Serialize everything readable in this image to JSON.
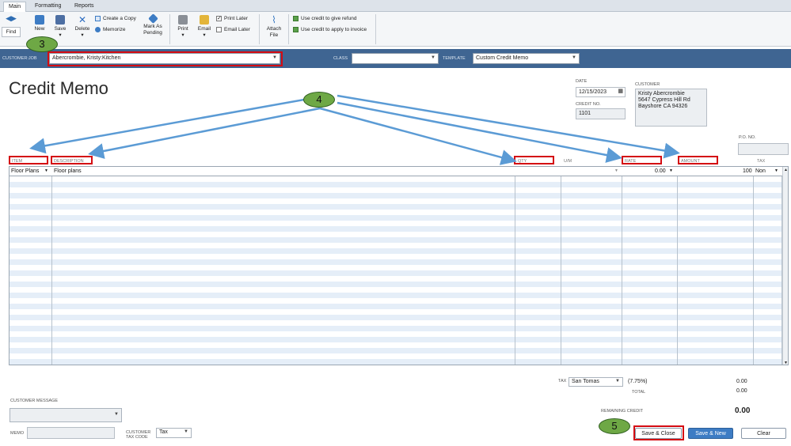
{
  "tabs": [
    "Main",
    "Formatting",
    "Reports"
  ],
  "ribbon": {
    "find": "Find",
    "new": "New",
    "save": "Save",
    "delete": "Delete",
    "create_copy": "Create a Copy",
    "memorize": "Memorize",
    "mark_as_pending": [
      "Mark As",
      "Pending"
    ],
    "print": "Print",
    "email": "Email",
    "print_later": "Print Later",
    "email_later": "Email Later",
    "attach_file": [
      "Attach",
      "File"
    ],
    "use_credit_refund": "Use credit to give refund",
    "use_credit_invoice": "Use credit to apply to invoice"
  },
  "custbar": {
    "customer_job_label": "CUSTOMER:JOB",
    "customer_job_value": "Abercrombie, Kristy:Kitchen",
    "class_label": "CLASS",
    "class_value": "",
    "template_label": "TEMPLATE",
    "template_value": "Custom Credit Memo"
  },
  "form": {
    "title": "Credit Memo",
    "date_label": "DATE",
    "date_value": "12/15/2023",
    "credit_no_label": "CREDIT NO.",
    "credit_no_value": "1101",
    "customer_label": "CUSTOMER",
    "customer_address": [
      "Kristy Abercrombie",
      "5647 Cypress Hill Rd",
      "Bayshore CA 94326"
    ],
    "po_no_label": "P.O. NO."
  },
  "grid": {
    "headers": {
      "item": "ITEM",
      "description": "DESCRIPTION",
      "qty": "QTY",
      "um": "U/M",
      "rate": "RATE",
      "amount": "AMOUNT",
      "tax": "TAX"
    },
    "row1": {
      "item": "Floor Plans",
      "description": "Floor plans",
      "rate": "0.00",
      "amount": "100",
      "tax": "Non"
    }
  },
  "totals": {
    "tax_label": "TAX",
    "tax_select": "San Tomas",
    "tax_rate": "(7.75%)",
    "tax_amount": "0.00",
    "total_label": "TOTAL",
    "total_amount": "0.00",
    "remaining_label": "REMAINING CREDIT",
    "remaining_amount": "0.00"
  },
  "footer": {
    "customer_message_label": "CUSTOMER MESSAGE",
    "memo_label": "MEMO",
    "customer_tax_code_label": [
      "CUSTOMER",
      "TAX CODE"
    ],
    "tax_code_value": "Tax",
    "save_close": "Save & Close",
    "save_new": "Save & New",
    "clear": "Clear"
  },
  "badges": {
    "b3": "3",
    "b4": "4",
    "b5": "5"
  },
  "colors": {
    "blue_bar": "#3f6592",
    "annotation_red": "#d40b12",
    "annotation_green": "#6ea845",
    "arrow_blue": "#5b9bd5"
  }
}
